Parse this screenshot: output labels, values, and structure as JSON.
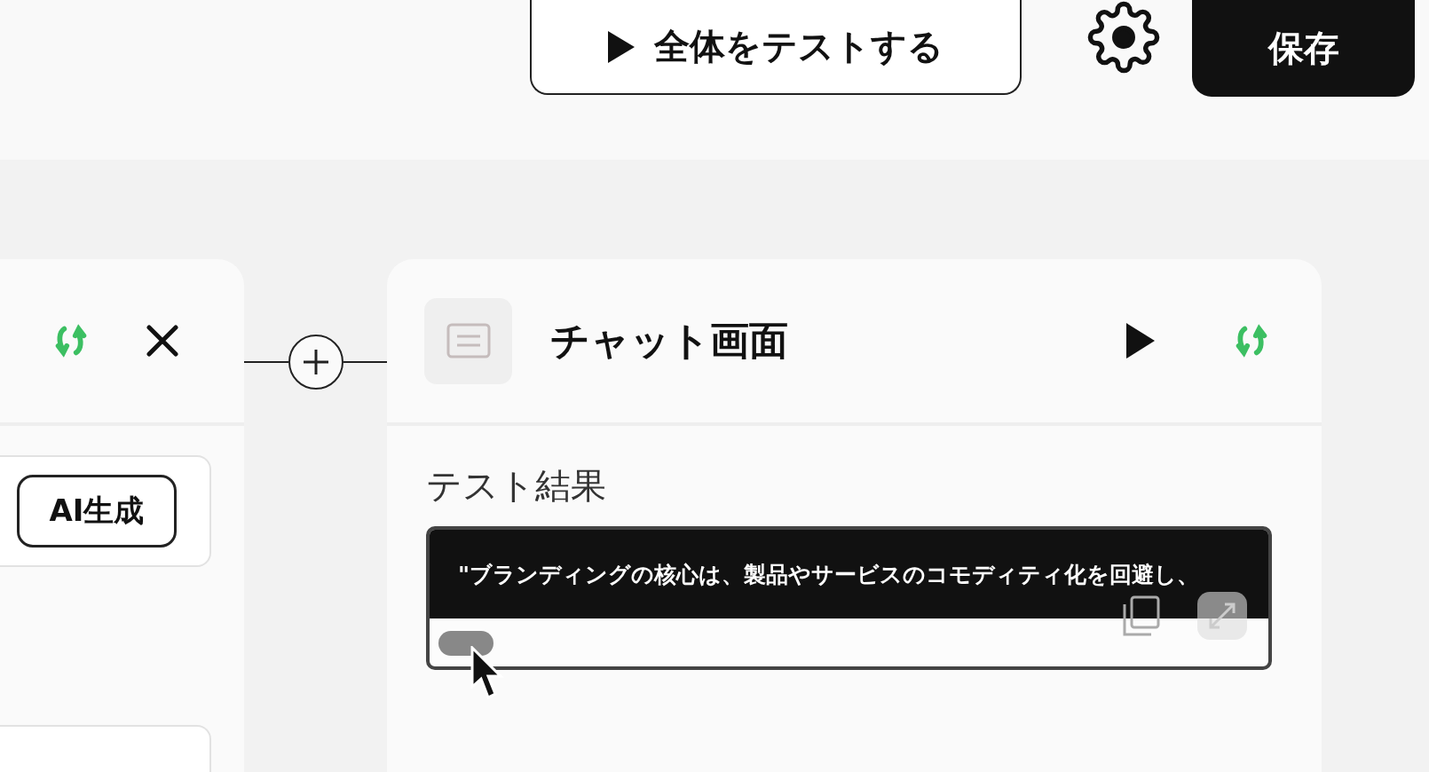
{
  "toolbar": {
    "test_all_button": {
      "label": "全体をテストする"
    },
    "save_button": {
      "label": "保存"
    }
  },
  "left_node": {
    "ai_button": {
      "label": "AI生成"
    }
  },
  "right_node": {
    "title": "チャット画面",
    "test_result": {
      "label": "テスト結果",
      "output": "\"ブランディングの核心は、製品やサービスのコモディティ化を回避し、"
    }
  }
}
